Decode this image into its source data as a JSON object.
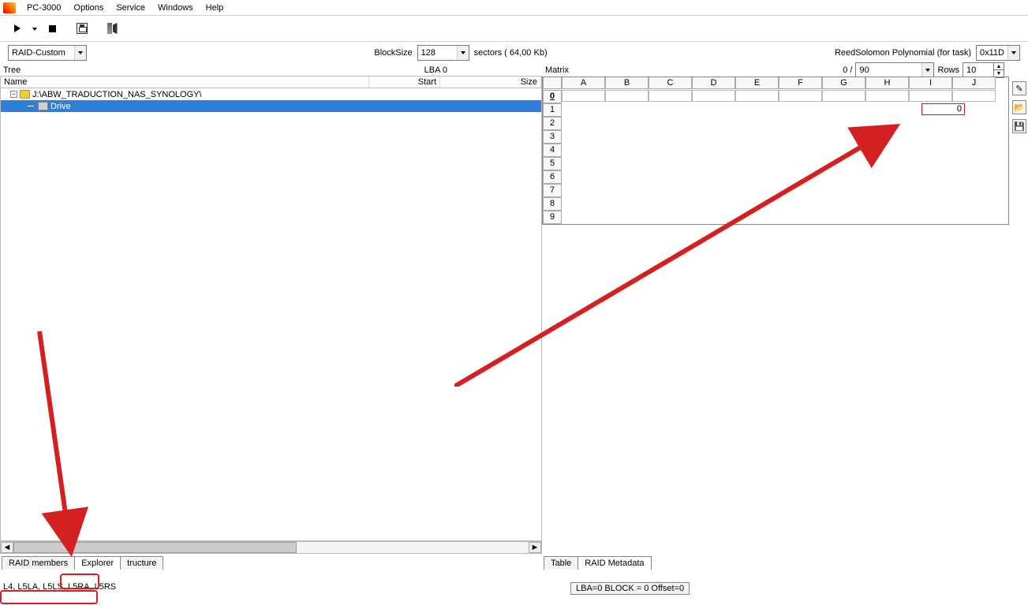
{
  "menu": {
    "app": "PC-3000",
    "items": [
      "Options",
      "Service",
      "Windows",
      "Help"
    ]
  },
  "config": {
    "raid_mode": "RAID-Custom",
    "blocksize_label": "BlockSize",
    "blocksize_value": "128",
    "sectors_label": "sectors ( 64,00 Kb)",
    "rs_label": "ReedSolomon Polynomial (for task)",
    "rs_value": "0x11D"
  },
  "tree": {
    "title": "Tree",
    "lba": "LBA  0",
    "cols": {
      "name": "Name",
      "start": "Start",
      "size": "Size"
    },
    "root": "J:\\ABW_TRADUCTION_NAS_SYNOLOGY\\",
    "child": "Drive"
  },
  "left_tabs": [
    "RAID members",
    "Explorer",
    "tructure"
  ],
  "matrix": {
    "title": "Matrix",
    "position": "0 /",
    "max": "90",
    "rows_label": "Rows",
    "rows_value": "10",
    "columns": [
      "A",
      "B",
      "C",
      "D",
      "E",
      "F",
      "G",
      "H",
      "I",
      "J"
    ],
    "rows": [
      "0",
      "1",
      "2",
      "3",
      "4",
      "5",
      "6",
      "7",
      "8",
      "9"
    ],
    "redcell_val": "0"
  },
  "right_tabs": [
    "Table",
    "RAID Metadata"
  ],
  "status": {
    "left": "L4, L5LA, L5LS, L5RA, L5RS",
    "right": "LBA=0 BLOCK = 0 Offset=0"
  }
}
